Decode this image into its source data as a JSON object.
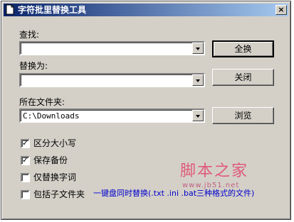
{
  "window": {
    "title": "字符批里替换工具",
    "close_glyph": "×"
  },
  "find": {
    "label": "查找:",
    "value": ""
  },
  "replace": {
    "label": "替换为:",
    "value": ""
  },
  "folder": {
    "label": "所在文件夹:",
    "value": "C:\\Downloads"
  },
  "buttons": {
    "replace_all": "全换",
    "close": "关闭",
    "browse": "浏览"
  },
  "options": [
    {
      "label": "区分大小写",
      "checked": true,
      "mark": "✓"
    },
    {
      "label": "保存备份",
      "checked": true,
      "mark": "✓"
    },
    {
      "label": "仅替换字词",
      "checked": false,
      "mark": ""
    },
    {
      "label": "包括子文件夹",
      "checked": false,
      "mark": ""
    }
  ],
  "watermark": {
    "name": "脚本之家",
    "url": "www.jb51.net"
  },
  "note": "一键盘同时替换(.txt .ini .bat三种格式的文件)",
  "icons": {
    "title": "document-icon",
    "combo": "dropdown-arrow-icon"
  }
}
